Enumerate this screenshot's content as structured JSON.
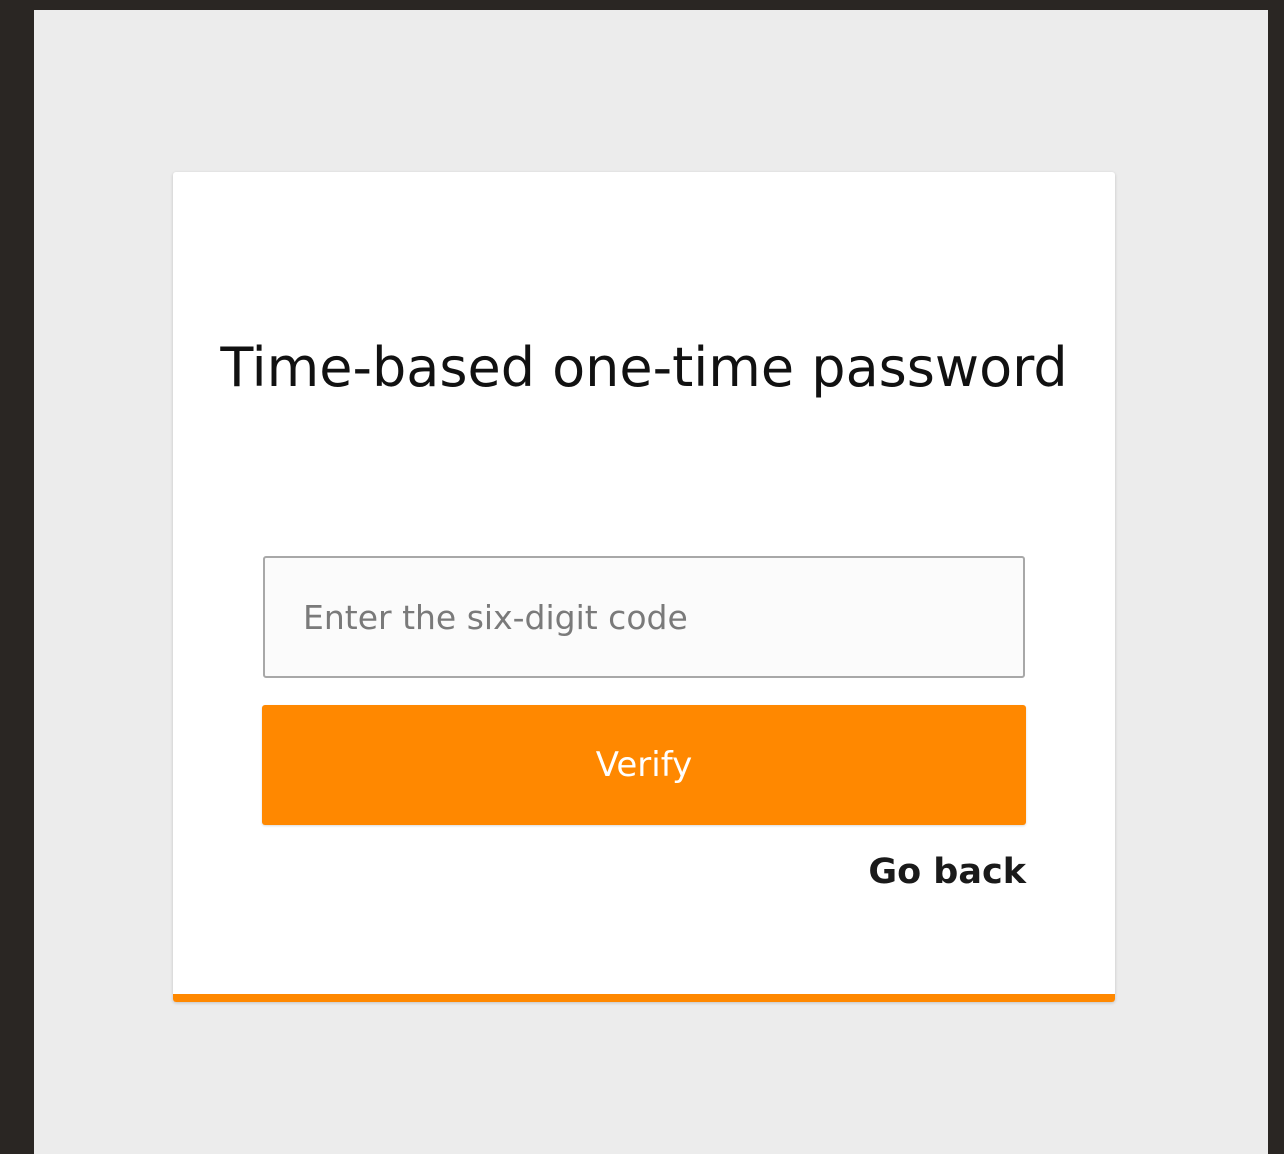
{
  "colors": {
    "accent": "#ff8800",
    "page_background": "#ececec",
    "frame": "#2a2623"
  },
  "form": {
    "title": "Time-based one-time password",
    "code_input": {
      "placeholder": "Enter the six-digit code",
      "value": ""
    },
    "verify_label": "Verify",
    "go_back_label": "Go back"
  }
}
